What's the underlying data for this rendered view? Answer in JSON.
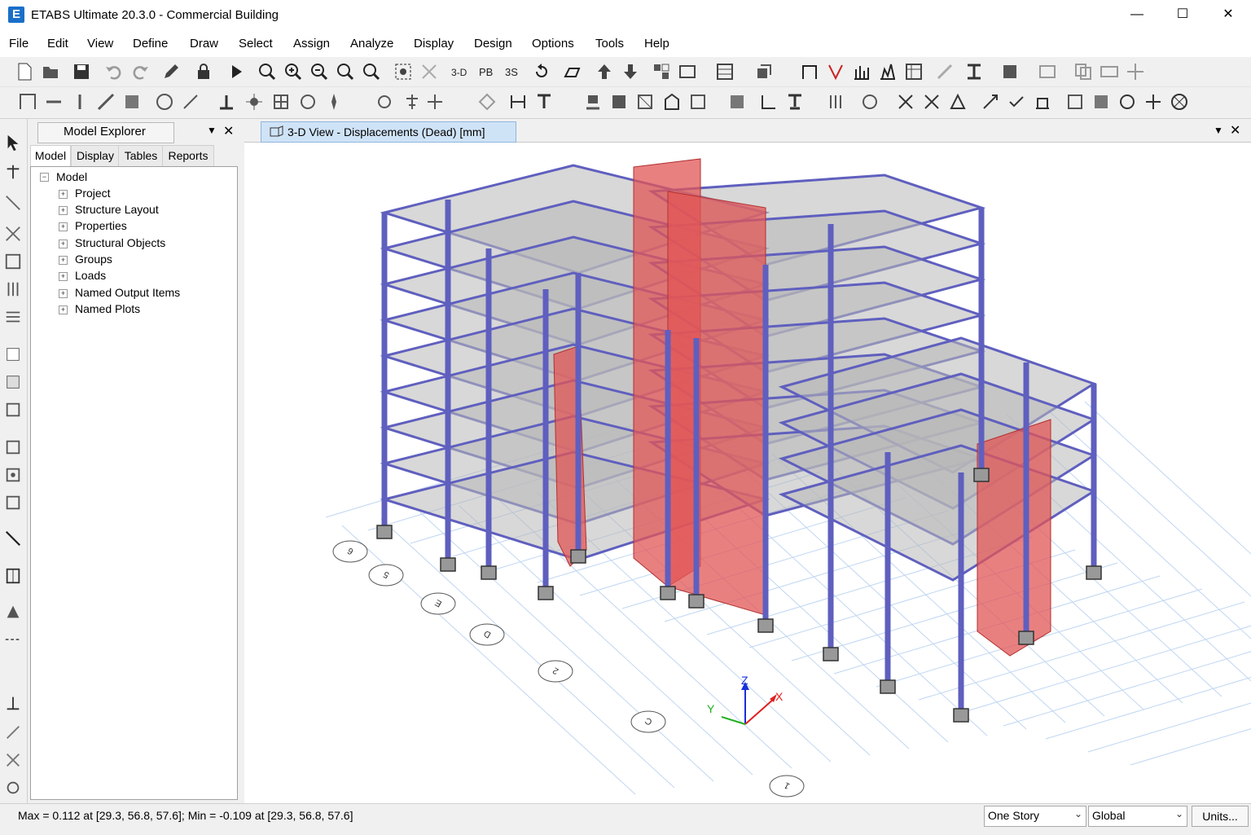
{
  "window": {
    "title": "ETABS Ultimate 20.3.0 - Commercial Building",
    "logo_letter": "E"
  },
  "menu": [
    "File",
    "Edit",
    "View",
    "Define",
    "Draw",
    "Select",
    "Assign",
    "Analyze",
    "Display",
    "Design",
    "Options",
    "Tools",
    "Help"
  ],
  "explorer": {
    "title": "Model Explorer",
    "tabs": [
      "Model",
      "Display",
      "Tables",
      "Reports"
    ],
    "tree_root": "Model",
    "tree_items": [
      "Project",
      "Structure Layout",
      "Properties",
      "Structural Objects",
      "Groups",
      "Loads",
      "Named Output Items",
      "Named Plots"
    ]
  },
  "view": {
    "tab_title": "3-D View - Displacements (Dead)  [mm]",
    "axes": {
      "x": "X",
      "y": "Y",
      "z": "Z"
    },
    "grid_bubbles": [
      "6",
      "5",
      "E",
      "D",
      "2",
      "C",
      "1"
    ]
  },
  "status": {
    "text": "Max = 0.112 at [29.3, 56.8, 57.6];   Min = -0.109 at [29.3, 56.8, 57.6]",
    "story": "One Story",
    "coord": "Global",
    "units_button": "Units..."
  },
  "colors": {
    "frame": "#5f5fbf",
    "wall": "#e25555",
    "slab": "#b8b8b8",
    "grid": "#bfd6f2",
    "accent": "#1a6fc9"
  }
}
